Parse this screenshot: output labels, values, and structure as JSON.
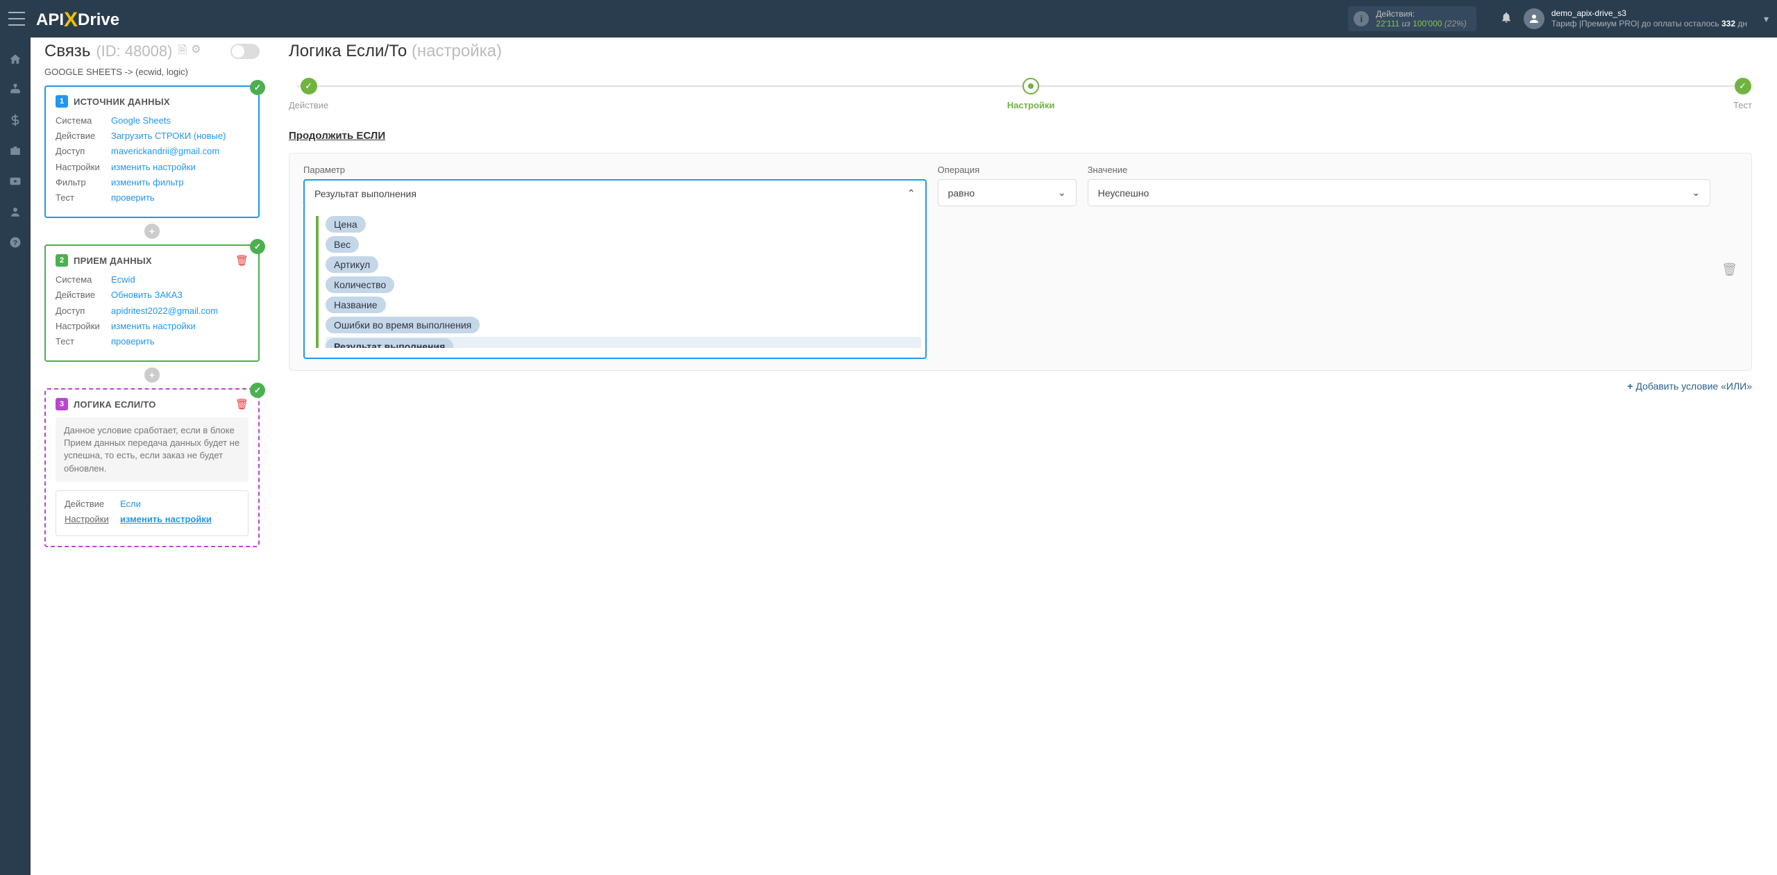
{
  "header": {
    "logo": {
      "api": "API",
      "drive": "Drive"
    },
    "actions": {
      "label": "Действия:",
      "used": "22'111",
      "sep": "из",
      "total": "100'000",
      "pct": "(22%)"
    },
    "user": {
      "name": "demo_apix-drive_s3",
      "plan_prefix": "Тариф |Премиум PRO|  до оплаты осталось ",
      "days": "332",
      "days_suffix": " дн"
    }
  },
  "sidebar": {
    "conn": {
      "title": "Связь",
      "id": "(ID: 48008)",
      "sub": "GOOGLE SHEETS -> (ecwid, logic)"
    },
    "block1": {
      "num": "1",
      "title": "ИСТОЧНИК ДАННЫХ",
      "rows": {
        "system_k": "Система",
        "system_v": "Google Sheets",
        "action_k": "Действие",
        "action_v": "Загрузить СТРОКИ (новые)",
        "access_k": "Доступ",
        "access_v": "maverickandrii@gmail.com",
        "settings_k": "Настройки",
        "settings_v": "изменить настройки",
        "filter_k": "Фильтр",
        "filter_v": "изменить фильтр",
        "test_k": "Тест",
        "test_v": "проверить"
      }
    },
    "block2": {
      "num": "2",
      "title": "ПРИЕМ ДАННЫХ",
      "rows": {
        "system_k": "Система",
        "system_v": "Ecwid",
        "action_k": "Действие",
        "action_v": "Обновить ЗАКАЗ",
        "access_k": "Доступ",
        "access_v": "apidritest2022@gmail.com",
        "settings_k": "Настройки",
        "settings_v": "изменить настройки",
        "test_k": "Тест",
        "test_v": "проверить"
      }
    },
    "block3": {
      "num": "3",
      "title": "ЛОГИКА ЕСЛИ/ТО",
      "note": "Данное условие сработает, если в блоке Прием данных передача данных будет не успешна, то есть, если заказ не будет обновлен.",
      "rows": {
        "action_k": "Действие",
        "action_v": "Если",
        "settings_k": "Настройки",
        "settings_v": "изменить настройки"
      }
    }
  },
  "content": {
    "title": "Логика Если/То",
    "title_sub": "(настройка)",
    "steps": {
      "s1": "Действие",
      "s2": "Настройки",
      "s3": "Тест"
    },
    "section": "Продолжить ЕСЛИ",
    "rule": {
      "param_label": "Параметр",
      "param_value": "Результат выполнения",
      "op_label": "Операция",
      "op_value": "равно",
      "val_label": "Значение",
      "val_value": "Неуспешно"
    },
    "dropdown": {
      "items": [
        "Цена",
        "Вес",
        "Артикул",
        "Количество",
        "Название",
        "Ошибки во время выполнения",
        "Результат выполнения"
      ],
      "selected": "Результат выполнения"
    },
    "add_or": "Добавить условие «ИЛИ»"
  }
}
